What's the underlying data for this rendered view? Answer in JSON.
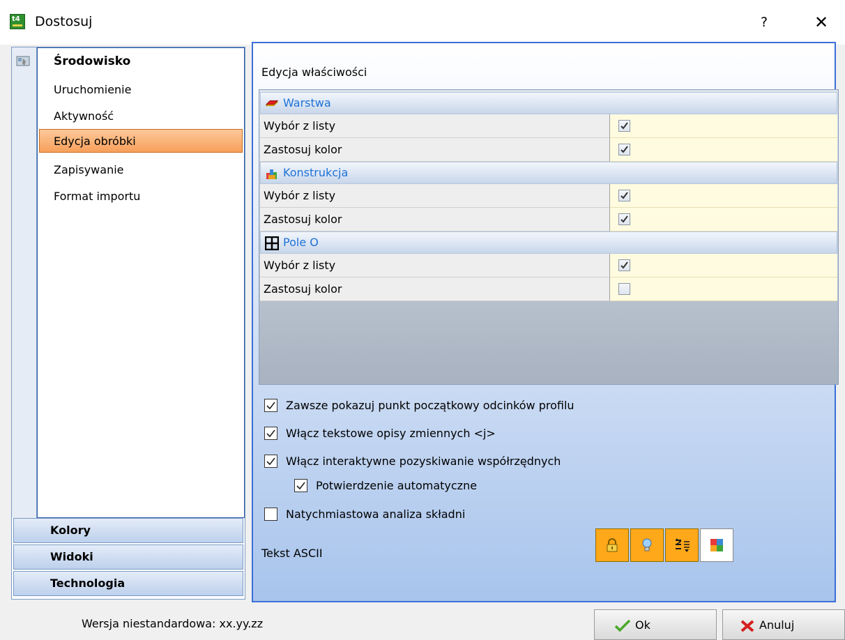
{
  "window": {
    "title": "Dostosuj",
    "help_label": "?",
    "close_label": "✕"
  },
  "sidebar": {
    "header": "Środowisko",
    "items": [
      {
        "label": "Uruchomienie",
        "selected": false
      },
      {
        "label": "Aktywność",
        "selected": false
      },
      {
        "label": "Edycja obróbki",
        "selected": true
      },
      {
        "label": "Zapisywanie",
        "selected": false
      },
      {
        "label": "Format importu",
        "selected": false
      }
    ],
    "categories": [
      "Kolory",
      "Widoki",
      "Technologia"
    ]
  },
  "main": {
    "section_title": "Edycja właściwości",
    "groups": [
      {
        "name": "Warstwa",
        "icon": "layer-icon",
        "rows": [
          {
            "label": "Wybór z listy",
            "checked": true
          },
          {
            "label": "Zastosuj kolor",
            "checked": true
          }
        ]
      },
      {
        "name": "Konstrukcja",
        "icon": "construction-icon",
        "rows": [
          {
            "label": "Wybór z listy",
            "checked": true
          },
          {
            "label": "Zastosuj kolor",
            "checked": true
          }
        ]
      },
      {
        "name": "Pole O",
        "icon": "grid-icon",
        "rows": [
          {
            "label": "Wybór z listy",
            "checked": true
          },
          {
            "label": "Zastosuj kolor",
            "checked": false
          }
        ]
      }
    ],
    "options": [
      {
        "label": "Zawsze pokazuj punkt początkowy odcinków profilu",
        "checked": true,
        "indent": false
      },
      {
        "label": "Włącz tekstowe opisy zmiennych <j>",
        "checked": true,
        "indent": false
      },
      {
        "label": "Włącz interaktywne pozyskiwanie współrzędnych",
        "checked": true,
        "indent": false
      },
      {
        "label": "Potwierdzenie automatyczne",
        "checked": true,
        "indent": true
      },
      {
        "label": "Natychmiastowa analiza składni",
        "checked": false,
        "indent": false
      }
    ],
    "ascii_label": "Tekst ASCII",
    "ascii_buttons": [
      "lock-icon",
      "bulb-icon",
      "sort-icon",
      "palette-icon"
    ]
  },
  "footer": {
    "version_text": "Wersja niestandardowa: xx.yy.zz",
    "ok_label": "Ok",
    "cancel_label": "Anuluj"
  },
  "colors": {
    "accent_blue": "#3a6fd8",
    "group_text": "#1e72d6",
    "selection_orange": "#f8a05a",
    "value_cell": "#fffbe0"
  }
}
